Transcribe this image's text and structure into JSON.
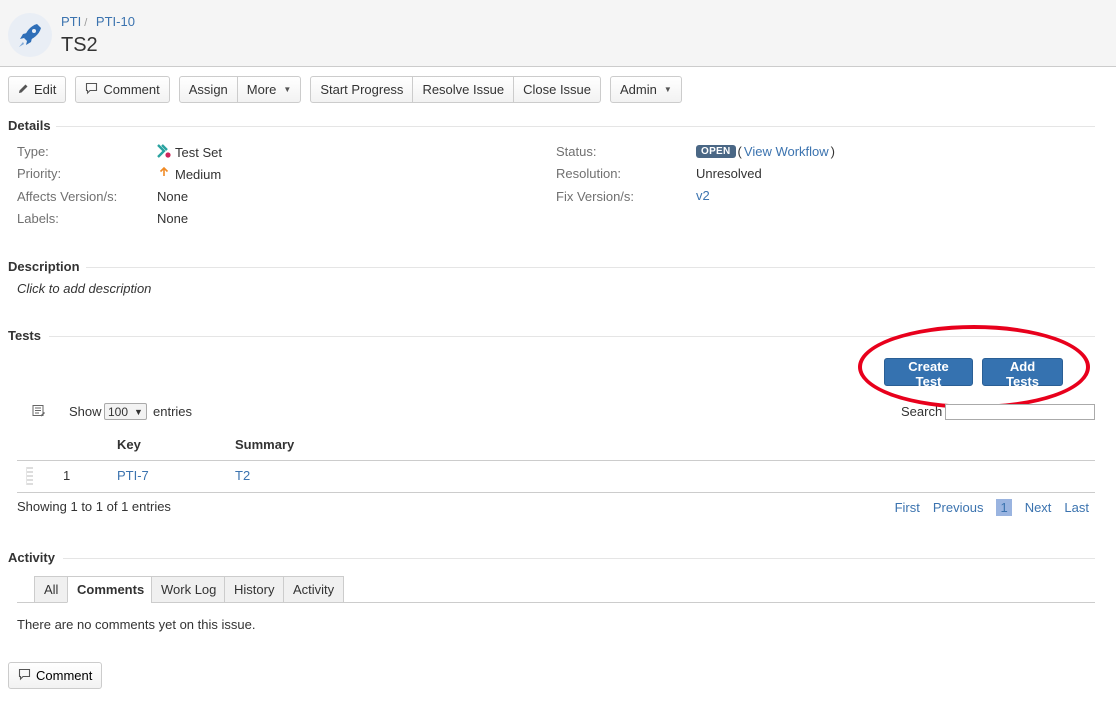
{
  "breadcrumb": {
    "project": "PTI",
    "issue_key": "PTI-10"
  },
  "issue": {
    "title": "TS2"
  },
  "toolbar": {
    "edit": "Edit",
    "comment": "Comment",
    "assign": "Assign",
    "more": "More",
    "start_progress": "Start Progress",
    "resolve_issue": "Resolve Issue",
    "close_issue": "Close Issue",
    "admin": "Admin"
  },
  "sections": {
    "details": "Details",
    "description": "Description",
    "tests": "Tests",
    "activity": "Activity"
  },
  "details": {
    "type_label": "Type:",
    "type_value": "Test Set",
    "priority_label": "Priority:",
    "priority_value": "Medium",
    "affects_label": "Affects Version/s:",
    "affects_value": "None",
    "labels_label": "Labels:",
    "labels_value": "None",
    "status_label": "Status:",
    "status_value": "OPEN",
    "view_workflow": "View Workflow",
    "resolution_label": "Resolution:",
    "resolution_value": "Unresolved",
    "fix_label": "Fix Version/s:",
    "fix_value": "v2"
  },
  "description": {
    "placeholder": "Click to add description"
  },
  "tests": {
    "create_test": "Create Test",
    "add_tests": "Add Tests",
    "show_label": "Show",
    "entries_label": "entries",
    "page_size": "100",
    "search_label": "Search",
    "columns": {
      "key": "Key",
      "summary": "Summary"
    },
    "rows": [
      {
        "rank": "1",
        "key": "PTI-7",
        "summary": "T2"
      }
    ],
    "info": "Showing 1 to 1 of 1 entries",
    "pager": {
      "first": "First",
      "previous": "Previous",
      "current": "1",
      "next": "Next",
      "last": "Last"
    }
  },
  "activity": {
    "tabs": [
      "All",
      "Comments",
      "Work Log",
      "History",
      "Activity"
    ],
    "active_tab": "Comments",
    "empty_message": "There are no comments yet on this issue."
  },
  "footer": {
    "comment": "Comment"
  },
  "colors": {
    "primary": "#3572b0",
    "link": "#3b73af",
    "highlight": "#e8001c",
    "status": "#4a6785"
  }
}
